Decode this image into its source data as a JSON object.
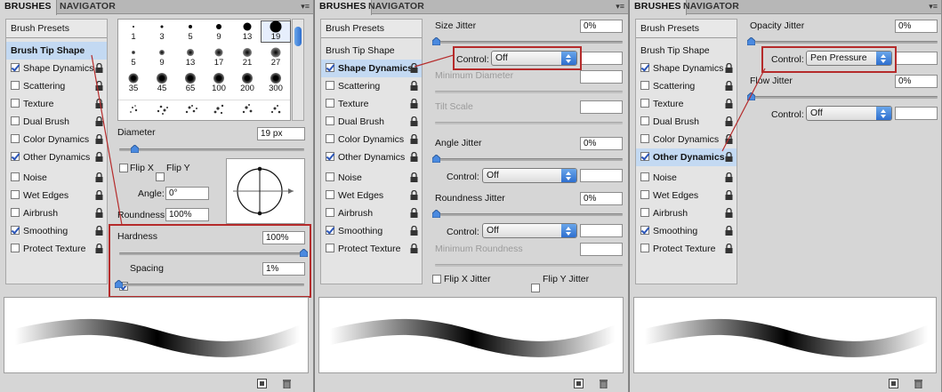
{
  "tabs": {
    "brushes": "BRUSHES",
    "navigator": "NAVIGATOR"
  },
  "sidebar": {
    "presets": "Brush Presets",
    "tip": "Brush Tip Shape",
    "items": [
      {
        "label": "Shape Dynamics",
        "checked": true
      },
      {
        "label": "Scattering",
        "checked": false
      },
      {
        "label": "Texture",
        "checked": false
      },
      {
        "label": "Dual Brush",
        "checked": false
      },
      {
        "label": "Color Dynamics",
        "checked": false
      },
      {
        "label": "Other Dynamics",
        "checked": true
      },
      {
        "label": "Noise",
        "checked": false
      },
      {
        "label": "Wet Edges",
        "checked": false
      },
      {
        "label": "Airbrush",
        "checked": false
      },
      {
        "label": "Smoothing",
        "checked": true
      },
      {
        "label": "Protect Texture",
        "checked": false
      }
    ]
  },
  "panel1": {
    "brush_sizes": [
      "1",
      "3",
      "5",
      "9",
      "13",
      "19",
      "5",
      "9",
      "13",
      "17",
      "21",
      "27",
      "35",
      "45",
      "65",
      "100",
      "200",
      "300"
    ],
    "diameter_label": "Diameter",
    "diameter_value": "19 px",
    "flip_x": "Flip X",
    "flip_y": "Flip Y",
    "angle_label": "Angle:",
    "angle_value": "0°",
    "roundness_label": "Roundness:",
    "roundness_value": "100%",
    "hardness_label": "Hardness",
    "hardness_value": "100%",
    "spacing_label": "Spacing",
    "spacing_value": "1%"
  },
  "panel2": {
    "size_jitter_label": "Size Jitter",
    "size_jitter_value": "0%",
    "control_label": "Control:",
    "control_value": "Off",
    "min_diameter_label": "Minimum Diameter",
    "tilt_scale_label": "Tilt Scale",
    "angle_jitter_label": "Angle Jitter",
    "angle_jitter_value": "0%",
    "angle_control_value": "Off",
    "roundness_jitter_label": "Roundness Jitter",
    "roundness_jitter_value": "0%",
    "roundness_control_value": "Off",
    "min_roundness_label": "Minimum Roundness",
    "flip_x_jitter": "Flip X Jitter",
    "flip_y_jitter": "Flip Y Jitter"
  },
  "panel3": {
    "opacity_jitter_label": "Opacity Jitter",
    "opacity_jitter_value": "0%",
    "control_label": "Control:",
    "opacity_control_value": "Pen Pressure",
    "flow_jitter_label": "Flow Jitter",
    "flow_jitter_value": "0%",
    "flow_control_value": "Off"
  },
  "colors": {
    "panel_bg": "#d6d6d6",
    "selection": "#c3d9f2",
    "highlight": "#b52b2b",
    "accent": "#2e6fcf"
  }
}
